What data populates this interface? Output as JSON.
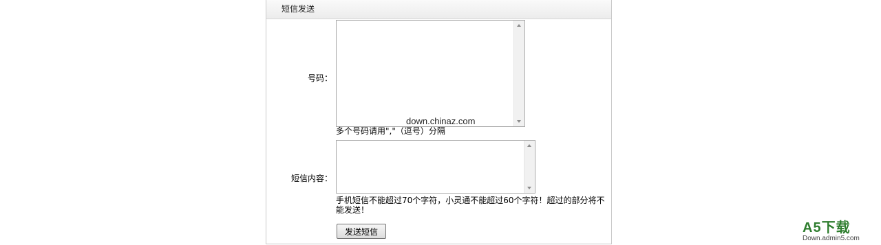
{
  "panel": {
    "title": "短信发送"
  },
  "form": {
    "numbers_label": "号码：",
    "numbers_value": "",
    "numbers_hint": "多个号码请用\",\"（逗号）分隔",
    "content_label": "短信内容：",
    "content_value": "",
    "content_hint": "手机短信不能超过70个字符，小灵通不能超过60个字符！超过的部分将不能发送！",
    "submit_label": "发送短信"
  },
  "watermark": "down.chinaz.com",
  "logo": {
    "main": "A5下载",
    "sub": "Down.admin5.com"
  },
  "colors": {
    "logo_green": "#2e7d2e",
    "border": "#c8c8c8"
  },
  "icons": [
    "scroll-up-arrow-icon",
    "scroll-down-arrow-icon"
  ]
}
